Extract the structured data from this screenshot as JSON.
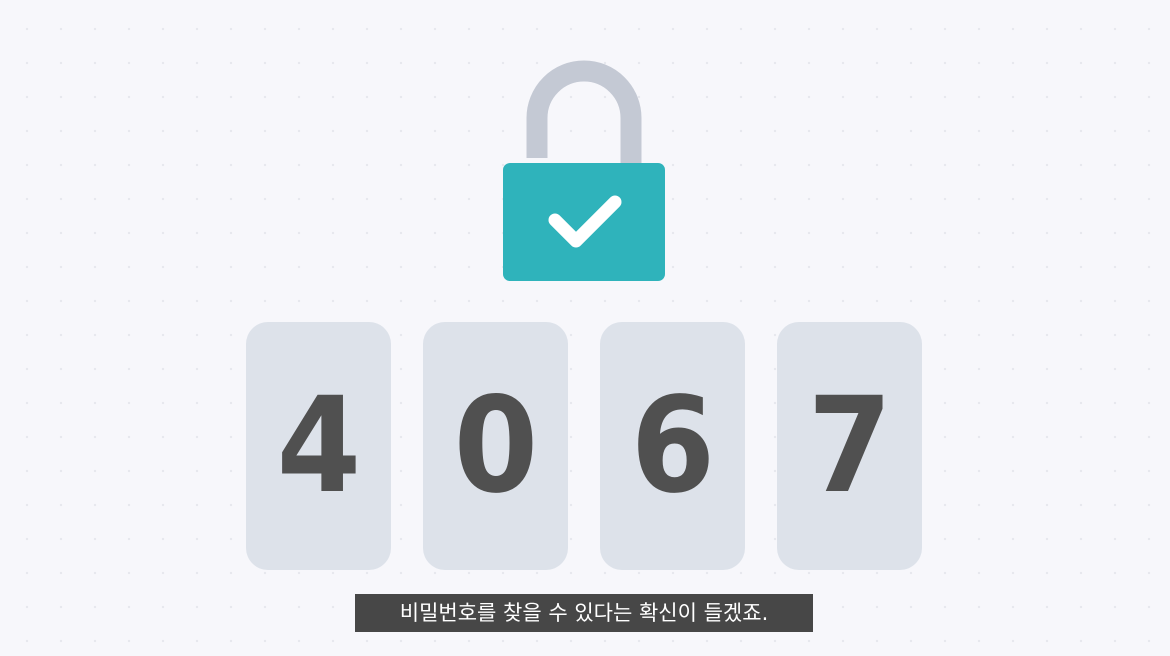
{
  "lock": {
    "state": "unlocked",
    "icon": "check-icon",
    "colors": {
      "body": "#2fb3bb",
      "shackle": "#c4c9d4",
      "check": "#ffffff"
    }
  },
  "combination": {
    "digits": [
      "4",
      "0",
      "6",
      "7"
    ],
    "colors": {
      "card": "#dde2ea",
      "digit": "#505050"
    }
  },
  "subtitle": {
    "text": "비밀번호를 찾을 수 있다는 확신이 들겠죠."
  }
}
